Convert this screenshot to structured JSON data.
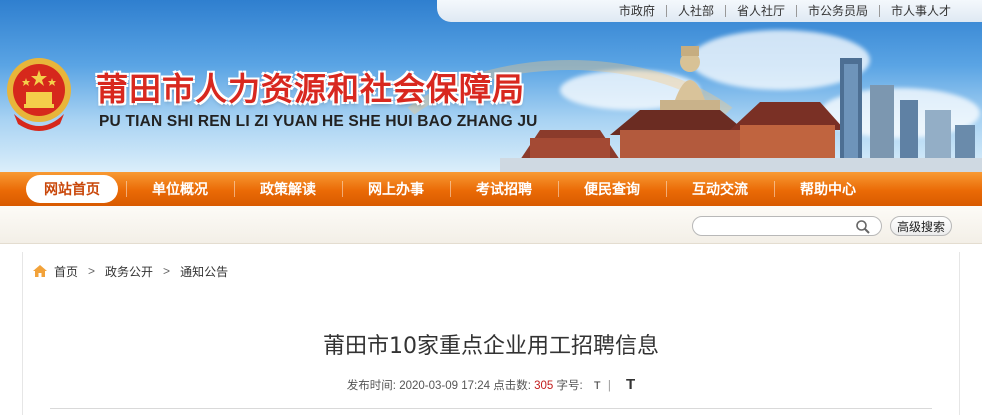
{
  "top_links": [
    "市政府",
    "人社部",
    "省人社厅",
    "市公务员局",
    "市人事人才"
  ],
  "site": {
    "title_cn": "莆田市人力资源和社会保障局",
    "title_en": "PU TIAN SHI REN LI ZI YUAN HE SHE HUI BAO ZHANG JU"
  },
  "nav": {
    "active": "网站首页",
    "items": [
      "单位概况",
      "政策解读",
      "网上办事",
      "考试招聘",
      "便民查询",
      "互动交流",
      "帮助中心"
    ]
  },
  "search": {
    "value": "",
    "advanced_label": "高级搜索"
  },
  "breadcrumb": {
    "home": "首页",
    "level1": "政务公开",
    "level2": "通知公告",
    "separator": ">"
  },
  "article": {
    "title": "莆田市10家重点企业用工招聘信息",
    "published_label": "发布时间:",
    "published": "2020-03-09 17:24",
    "clicks_label": "点击数:",
    "clicks": "305",
    "font_label": "字号:",
    "font_small": "T",
    "font_sep": "|",
    "font_big": "T"
  },
  "colors": {
    "nav_orange": "#ea6a06",
    "title_red": "#d8281f",
    "count_red": "#c21c1c"
  },
  "icons": [
    "national-emblem-icon",
    "search-icon",
    "home-icon"
  ]
}
